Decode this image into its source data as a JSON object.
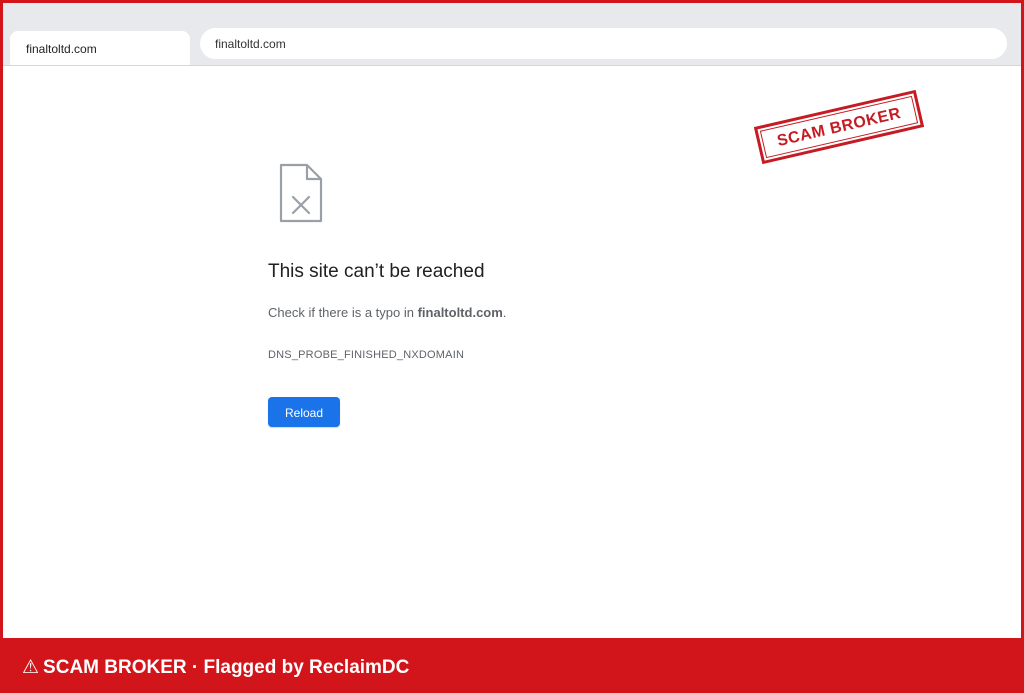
{
  "browser": {
    "tab_title": "finaltoltd.com",
    "address_bar": "finaltoltd.com"
  },
  "error_page": {
    "icon": "broken-file-icon",
    "title": "This site can’t be reached",
    "hint_prefix": "Check if there is a typo in ",
    "hint_domain": "finaltoltd.com",
    "hint_suffix": ".",
    "error_code": "DNS_PROBE_FINISHED_NXDOMAIN",
    "reload_label": "Reload"
  },
  "stamp": {
    "text": "SCAM BROKER",
    "color": "#c51b23"
  },
  "banner": {
    "icon": "warning-icon",
    "warning_glyph": "⚠",
    "text": "SCAM BROKER · Flagged by ReclaimDC",
    "color": "#d2151a"
  },
  "colors": {
    "accent_button": "#1a73e8",
    "frame_border": "#d2151a"
  }
}
